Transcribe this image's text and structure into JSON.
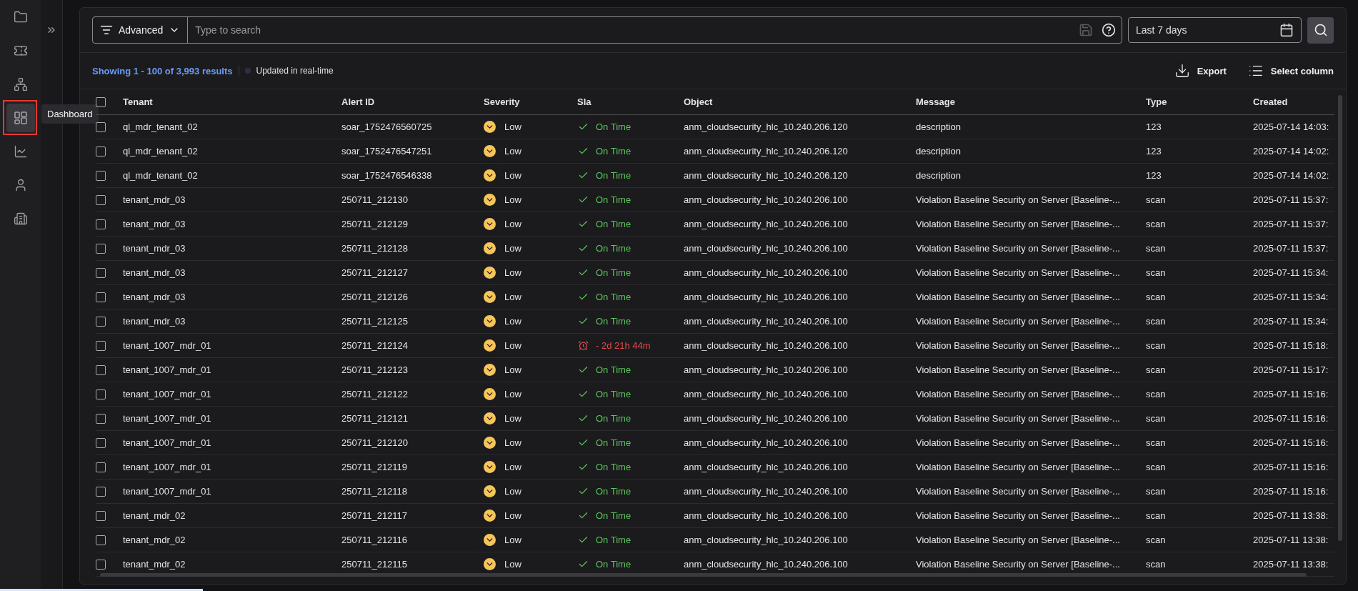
{
  "sidebar": {
    "items": [
      {
        "kind": "folder",
        "selected": false
      },
      {
        "kind": "ticket",
        "selected": false
      },
      {
        "kind": "network",
        "selected": false
      },
      {
        "kind": "dashboard",
        "selected": true
      },
      {
        "kind": "chart",
        "selected": false
      },
      {
        "kind": "user",
        "selected": false
      },
      {
        "kind": "buildings",
        "selected": false
      }
    ],
    "tooltip": "Dashboard"
  },
  "search": {
    "filter_label": "Advanced",
    "placeholder": "Type to search",
    "date_range": "Last 7 days"
  },
  "summary": {
    "showing": "Showing 1 - 100 of 3,993 results",
    "realtime": "Updated in real-time"
  },
  "actions": [
    "Export",
    "Select column"
  ],
  "table": {
    "columns": [
      "Tenant",
      "Alert ID",
      "Severity",
      "Sla",
      "Object",
      "Message",
      "Type",
      "Created"
    ],
    "all_checked": false,
    "rows": [
      {
        "checked": false,
        "tenant": "ql_mdr_tenant_02",
        "alert_id": "soar_1752476560725",
        "severity": "Low",
        "sla": {
          "kind": "on_time",
          "text": "On Time"
        },
        "object": "anm_cloudsecurity_hlc_10.240.206.120",
        "message": "description",
        "type": "123",
        "created": "2025-07-14 14:03:"
      },
      {
        "checked": false,
        "tenant": "ql_mdr_tenant_02",
        "alert_id": "soar_1752476547251",
        "severity": "Low",
        "sla": {
          "kind": "on_time",
          "text": "On Time"
        },
        "object": "anm_cloudsecurity_hlc_10.240.206.120",
        "message": "description",
        "type": "123",
        "created": "2025-07-14 14:02:"
      },
      {
        "checked": false,
        "tenant": "ql_mdr_tenant_02",
        "alert_id": "soar_1752476546338",
        "severity": "Low",
        "sla": {
          "kind": "on_time",
          "text": "On Time"
        },
        "object": "anm_cloudsecurity_hlc_10.240.206.120",
        "message": "description",
        "type": "123",
        "created": "2025-07-14 14:02:"
      },
      {
        "checked": false,
        "tenant": "tenant_mdr_03",
        "alert_id": "250711_212130",
        "severity": "Low",
        "sla": {
          "kind": "on_time",
          "text": "On Time"
        },
        "object": "anm_cloudsecurity_hlc_10.240.206.100",
        "message": "Violation Baseline Security on Server [Baseline-...",
        "type": "scan",
        "created": "2025-07-11 15:37:"
      },
      {
        "checked": false,
        "tenant": "tenant_mdr_03",
        "alert_id": "250711_212129",
        "severity": "Low",
        "sla": {
          "kind": "on_time",
          "text": "On Time"
        },
        "object": "anm_cloudsecurity_hlc_10.240.206.100",
        "message": "Violation Baseline Security on Server [Baseline-...",
        "type": "scan",
        "created": "2025-07-11 15:37:"
      },
      {
        "checked": false,
        "tenant": "tenant_mdr_03",
        "alert_id": "250711_212128",
        "severity": "Low",
        "sla": {
          "kind": "on_time",
          "text": "On Time"
        },
        "object": "anm_cloudsecurity_hlc_10.240.206.100",
        "message": "Violation Baseline Security on Server [Baseline-...",
        "type": "scan",
        "created": "2025-07-11 15:37:"
      },
      {
        "checked": false,
        "tenant": "tenant_mdr_03",
        "alert_id": "250711_212127",
        "severity": "Low",
        "sla": {
          "kind": "on_time",
          "text": "On Time"
        },
        "object": "anm_cloudsecurity_hlc_10.240.206.100",
        "message": "Violation Baseline Security on Server [Baseline-...",
        "type": "scan",
        "created": "2025-07-11 15:34:"
      },
      {
        "checked": false,
        "tenant": "tenant_mdr_03",
        "alert_id": "250711_212126",
        "severity": "Low",
        "sla": {
          "kind": "on_time",
          "text": "On Time"
        },
        "object": "anm_cloudsecurity_hlc_10.240.206.100",
        "message": "Violation Baseline Security on Server [Baseline-...",
        "type": "scan",
        "created": "2025-07-11 15:34:"
      },
      {
        "checked": false,
        "tenant": "tenant_mdr_03",
        "alert_id": "250711_212125",
        "severity": "Low",
        "sla": {
          "kind": "on_time",
          "text": "On Time"
        },
        "object": "anm_cloudsecurity_hlc_10.240.206.100",
        "message": "Violation Baseline Security on Server [Baseline-...",
        "type": "scan",
        "created": "2025-07-11 15:34:"
      },
      {
        "checked": false,
        "tenant": "tenant_1007_mdr_01",
        "alert_id": "250711_212124",
        "severity": "Low",
        "sla": {
          "kind": "overdue",
          "text": "- 2d 21h 44m"
        },
        "object": "anm_cloudsecurity_hlc_10.240.206.100",
        "message": "Violation Baseline Security on Server [Baseline-...",
        "type": "scan",
        "created": "2025-07-11 15:18:"
      },
      {
        "checked": false,
        "tenant": "tenant_1007_mdr_01",
        "alert_id": "250711_212123",
        "severity": "Low",
        "sla": {
          "kind": "on_time",
          "text": "On Time"
        },
        "object": "anm_cloudsecurity_hlc_10.240.206.100",
        "message": "Violation Baseline Security on Server [Baseline-...",
        "type": "scan",
        "created": "2025-07-11 15:17:"
      },
      {
        "checked": false,
        "tenant": "tenant_1007_mdr_01",
        "alert_id": "250711_212122",
        "severity": "Low",
        "sla": {
          "kind": "on_time",
          "text": "On Time"
        },
        "object": "anm_cloudsecurity_hlc_10.240.206.100",
        "message": "Violation Baseline Security on Server [Baseline-...",
        "type": "scan",
        "created": "2025-07-11 15:16:"
      },
      {
        "checked": false,
        "tenant": "tenant_1007_mdr_01",
        "alert_id": "250711_212121",
        "severity": "Low",
        "sla": {
          "kind": "on_time",
          "text": "On Time"
        },
        "object": "anm_cloudsecurity_hlc_10.240.206.100",
        "message": "Violation Baseline Security on Server [Baseline-...",
        "type": "scan",
        "created": "2025-07-11 15:16:"
      },
      {
        "checked": false,
        "tenant": "tenant_1007_mdr_01",
        "alert_id": "250711_212120",
        "severity": "Low",
        "sla": {
          "kind": "on_time",
          "text": "On Time"
        },
        "object": "anm_cloudsecurity_hlc_10.240.206.100",
        "message": "Violation Baseline Security on Server [Baseline-...",
        "type": "scan",
        "created": "2025-07-11 15:16:"
      },
      {
        "checked": false,
        "tenant": "tenant_1007_mdr_01",
        "alert_id": "250711_212119",
        "severity": "Low",
        "sla": {
          "kind": "on_time",
          "text": "On Time"
        },
        "object": "anm_cloudsecurity_hlc_10.240.206.100",
        "message": "Violation Baseline Security on Server [Baseline-...",
        "type": "scan",
        "created": "2025-07-11 15:16:"
      },
      {
        "checked": false,
        "tenant": "tenant_1007_mdr_01",
        "alert_id": "250711_212118",
        "severity": "Low",
        "sla": {
          "kind": "on_time",
          "text": "On Time"
        },
        "object": "anm_cloudsecurity_hlc_10.240.206.100",
        "message": "Violation Baseline Security on Server [Baseline-...",
        "type": "scan",
        "created": "2025-07-11 15:16:"
      },
      {
        "checked": false,
        "tenant": "tenant_mdr_02",
        "alert_id": "250711_212117",
        "severity": "Low",
        "sla": {
          "kind": "on_time",
          "text": "On Time"
        },
        "object": "anm_cloudsecurity_hlc_10.240.206.100",
        "message": "Violation Baseline Security on Server [Baseline-...",
        "type": "scan",
        "created": "2025-07-11 13:38:"
      },
      {
        "checked": false,
        "tenant": "tenant_mdr_02",
        "alert_id": "250711_212116",
        "severity": "Low",
        "sla": {
          "kind": "on_time",
          "text": "On Time"
        },
        "object": "anm_cloudsecurity_hlc_10.240.206.100",
        "message": "Violation Baseline Security on Server [Baseline-...",
        "type": "scan",
        "created": "2025-07-11 13:38:"
      },
      {
        "checked": false,
        "tenant": "tenant_mdr_02",
        "alert_id": "250711_212115",
        "severity": "Low",
        "sla": {
          "kind": "on_time",
          "text": "On Time"
        },
        "object": "anm_cloudsecurity_hlc_10.240.206.100",
        "message": "Violation Baseline Security on Server [Baseline-...",
        "type": "scan",
        "created": "2025-07-11 13:38:"
      }
    ]
  }
}
